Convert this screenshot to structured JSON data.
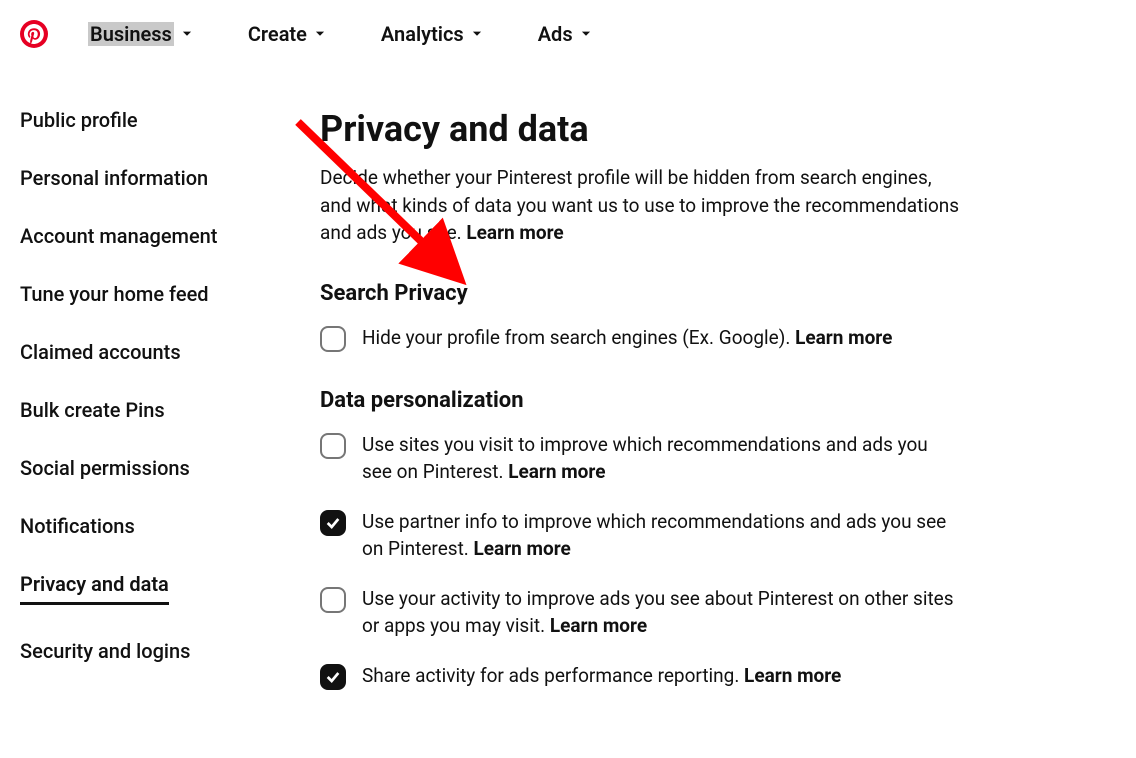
{
  "nav": {
    "items": [
      {
        "label": "Business",
        "highlight": true,
        "chevron": true
      },
      {
        "label": "Create",
        "highlight": false,
        "chevron": true
      },
      {
        "label": "Analytics",
        "highlight": false,
        "chevron": true
      },
      {
        "label": "Ads",
        "highlight": false,
        "chevron": true
      }
    ]
  },
  "sidebar": {
    "items": [
      {
        "label": "Public profile",
        "active": false
      },
      {
        "label": "Personal information",
        "active": false
      },
      {
        "label": "Account management",
        "active": false
      },
      {
        "label": "Tune your home feed",
        "active": false
      },
      {
        "label": "Claimed accounts",
        "active": false
      },
      {
        "label": "Bulk create Pins",
        "active": false
      },
      {
        "label": "Social permissions",
        "active": false
      },
      {
        "label": "Notifications",
        "active": false
      },
      {
        "label": "Privacy and data",
        "active": true
      },
      {
        "label": "Security and logins",
        "active": false
      }
    ]
  },
  "page": {
    "title": "Privacy and data",
    "description": "Decide whether your Pinterest profile will be hidden from search engines, and what kinds of data you want us to use to improve the recommendations and ads you see. ",
    "learn_more": "Learn more"
  },
  "sections": [
    {
      "title": "Search Privacy",
      "options": [
        {
          "checked": false,
          "text": "Hide your profile from search engines (Ex. Google). ",
          "learn_more": "Learn more"
        }
      ]
    },
    {
      "title": "Data personalization",
      "options": [
        {
          "checked": false,
          "text": "Use sites you visit to improve which recommendations and ads you see on Pinterest. ",
          "learn_more": "Learn more"
        },
        {
          "checked": true,
          "text": "Use partner info to improve which recommendations and ads you see on Pinterest. ",
          "learn_more": "Learn more"
        },
        {
          "checked": false,
          "text": "Use your activity to improve ads you see about Pinterest on other sites or apps you may visit. ",
          "learn_more": "Learn more"
        },
        {
          "checked": true,
          "text": "Share activity for ads performance reporting. ",
          "learn_more": "Learn more"
        }
      ]
    }
  ],
  "annotation": {
    "arrow_color": "#ff0000"
  }
}
